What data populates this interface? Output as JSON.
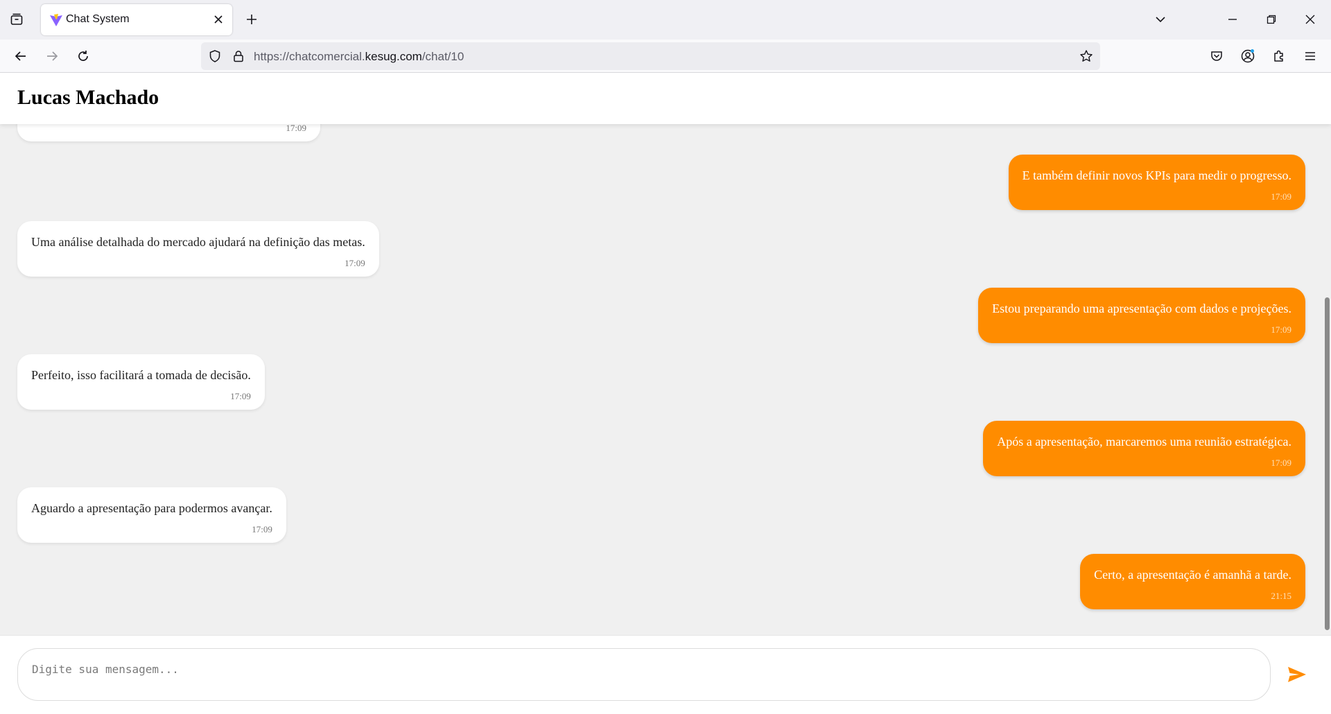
{
  "browser": {
    "tab_title": "Chat System",
    "url_prefix": "https://chatcomercial.",
    "url_domain": "kesug.com",
    "url_path": "/chat/10"
  },
  "chat": {
    "contact_name": "Lucas Machado",
    "messages": [
      {
        "direction": "received",
        "text": "",
        "time": "17:09"
      },
      {
        "direction": "sent",
        "text": "E também definir novos KPIs para medir o progresso.",
        "time": "17:09"
      },
      {
        "direction": "received",
        "text": "Uma análise detalhada do mercado ajudará na definição das metas.",
        "time": "17:09"
      },
      {
        "direction": "sent",
        "text": "Estou preparando uma apresentação com dados e projeções.",
        "time": "17:09"
      },
      {
        "direction": "received",
        "text": "Perfeito, isso facilitará a tomada de decisão.",
        "time": "17:09"
      },
      {
        "direction": "sent",
        "text": "Após a apresentação, marcaremos uma reunião estratégica.",
        "time": "17:09"
      },
      {
        "direction": "received",
        "text": "Aguardo a apresentação para podermos avançar.",
        "time": "17:09"
      },
      {
        "direction": "sent",
        "text": "Certo, a apresentação é amanhã a tarde.",
        "time": "21:15"
      }
    ]
  },
  "composer": {
    "placeholder": "Digite sua mensagem...",
    "send_icon": "send-icon"
  },
  "colors": {
    "sent_bubble": "#ff8c00",
    "received_bubble": "#ffffff",
    "page_background": "#f0f0f0"
  }
}
